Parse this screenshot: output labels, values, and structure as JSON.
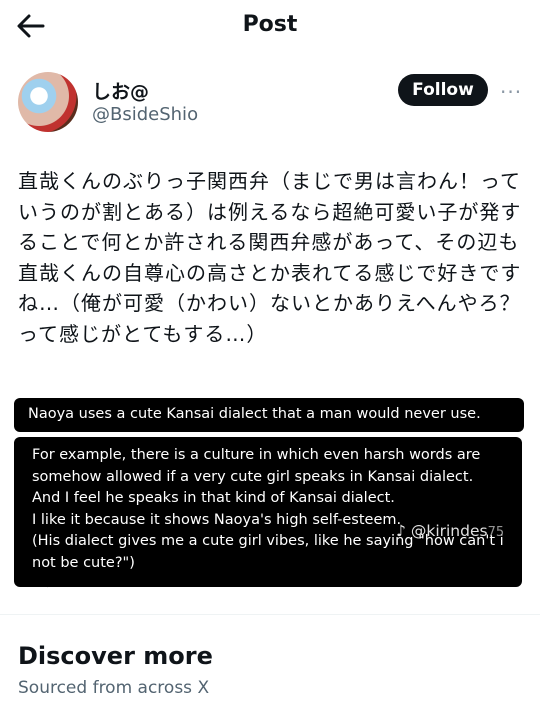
{
  "header": {
    "back_icon": "arrow-left-icon",
    "title": "Post"
  },
  "author": {
    "name": "しお@",
    "handle": "@BsideShio",
    "avatar": "avatar-photo"
  },
  "follow_label": "Follow",
  "more_label": "···",
  "post": {
    "text": "直哉くんのぶりっ子関西弁（まじで男は言わん！っていうのが割とある）は例えるなら超絶可愛い子が発することで何とか許される関西弁感があって、その辺も直哉くんの自尊心の高さとか表れてる感じで好きですね…（俺が可愛（かわい）ないとかありえへんやろ？って感じがとてもする…）"
  },
  "actions": {
    "reply_icon": "reply-icon",
    "like_icon": "heart-icon",
    "like_color": "#f91880",
    "bookmark_icon": "bookmark-icon",
    "share_icon": "share-icon"
  },
  "discover": {
    "title": "Discover more",
    "subtitle": "Sourced from across X"
  },
  "overlay": {
    "line1": "Naoya uses a cute Kansai dialect that a man would never use.",
    "line2": "For example, there is a culture in which even harsh words are somehow allowed if a very cute girl speaks in Kansai dialect.\nAnd I feel he speaks in that kind of Kansai dialect.\nI like it because it shows Naoya's high self-esteem.\n(His dialect gives me a cute girl vibes, like he saying \"how can't i not be cute?\")",
    "watermark": "@kirindes",
    "watermark_tail": "75",
    "watermark_icon": "tiktok-icon"
  }
}
